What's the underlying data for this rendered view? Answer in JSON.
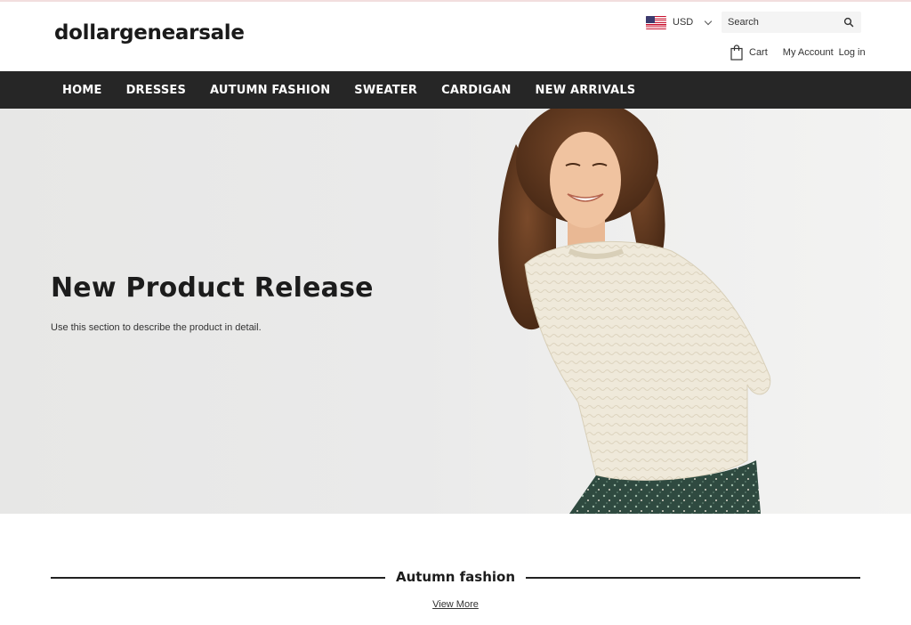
{
  "store": {
    "name": "dollargenearsale"
  },
  "header": {
    "currency": {
      "code": "USD",
      "flag_icon": "us-flag-icon"
    },
    "search": {
      "placeholder": "Search"
    },
    "cart_label": "Cart",
    "account_label": "My Account",
    "login_label": "Log in"
  },
  "nav": {
    "items": [
      "HOME",
      "DRESSES",
      "AUTUMN FASHION",
      "SWEATER",
      "CARDIGAN",
      "NEW ARRIVALS"
    ]
  },
  "hero": {
    "title": "New Product Release",
    "description": "Use this section to describe the product in detail."
  },
  "collection": {
    "title": "Autumn fashion",
    "view_more": "View More"
  },
  "colors": {
    "nav_background": "#262626",
    "hero_background": "#e9e9e8",
    "text": "#1c1c1c"
  }
}
